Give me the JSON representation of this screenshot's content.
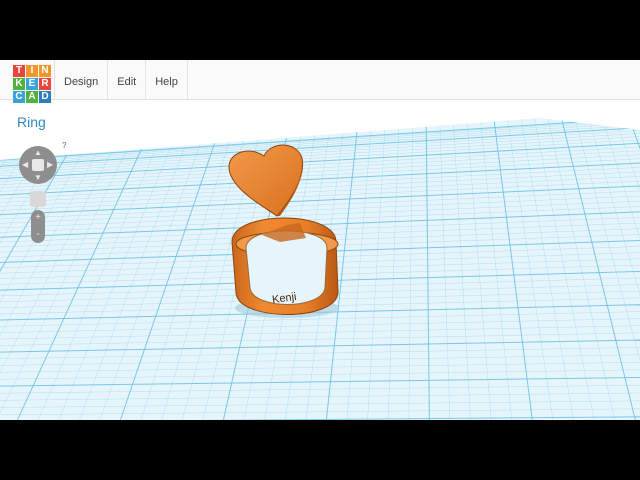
{
  "app": {
    "logo_letters": [
      "T",
      "I",
      "N",
      "K",
      "E",
      "R",
      "C",
      "A",
      "D"
    ],
    "logo_colors": [
      "#e8463b",
      "#f0962c",
      "#f0962c",
      "#4fb33a",
      "#3aa4d8",
      "#e8463b",
      "#3aa4d8",
      "#4fb33a",
      "#2d7fb8"
    ]
  },
  "menu": {
    "items": [
      {
        "label": "Design"
      },
      {
        "label": "Edit"
      },
      {
        "label": "Help"
      }
    ]
  },
  "design": {
    "title": "Ring",
    "engraving_text": "Kenji",
    "object_color": "#e87e28"
  },
  "view_controls": {
    "help_label": "?",
    "zoom_in_label": "+",
    "zoom_out_label": "-"
  },
  "workplane": {
    "grid_color": "#6ec3e6",
    "background": "#e6f5fb"
  }
}
